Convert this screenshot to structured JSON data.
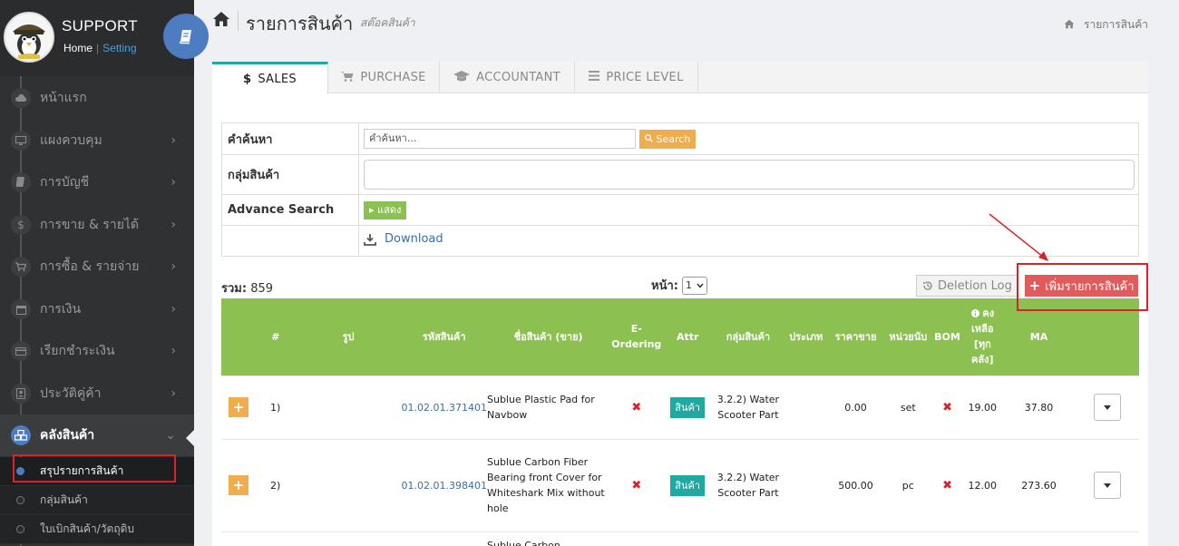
{
  "sidebar": {
    "brand_title": "SUPPORT",
    "home_label": "Home",
    "separator": "|",
    "setting_label": "Setting",
    "items": [
      {
        "label": "หน้าแรก",
        "icon": "cloud-icon",
        "has_chevron": false
      },
      {
        "label": "แผงควบคุม",
        "icon": "monitor-icon",
        "has_chevron": true
      },
      {
        "label": "การบัญชี",
        "icon": "book-icon",
        "has_chevron": true
      },
      {
        "label": "การขาย & รายได้",
        "icon": "dollar-icon",
        "has_chevron": true
      },
      {
        "label": "การซื้อ & รายจ่าย",
        "icon": "cart-icon",
        "has_chevron": true
      },
      {
        "label": "การเงิน",
        "icon": "calendar-icon",
        "has_chevron": true
      },
      {
        "label": "เรียกชำระเงิน",
        "icon": "credit-card-icon",
        "has_chevron": true
      },
      {
        "label": "ประวัติคู่ค้า",
        "icon": "contact-icon",
        "has_chevron": true
      },
      {
        "label": "คลังสินค้า",
        "icon": "cubes-icon",
        "has_chevron": true,
        "active": true
      }
    ],
    "sub_items": [
      {
        "label": "สรุปรายการสินค้า",
        "current": true
      },
      {
        "label": "กลุ่มสินค้า"
      },
      {
        "label": "ใบเบิกสินค้า/วัตถุดิบ"
      }
    ]
  },
  "header": {
    "title": "รายการสินค้า",
    "subtitle": "สต๊อคสินค้า",
    "breadcrumb": "รายการสินค้า"
  },
  "tabs": [
    {
      "label": "SALES",
      "icon": "$",
      "active": true
    },
    {
      "label": "PURCHASE",
      "icon": "cart-icon"
    },
    {
      "label": "ACCOUNTANT",
      "icon": "graduation-cap-icon"
    },
    {
      "label": "PRICE LEVEL",
      "icon": "list-icon"
    }
  ],
  "search": {
    "keyword_label": "คำค้นหา",
    "keyword_placeholder": "คำค้นหา...",
    "search_button": "Search",
    "group_label": "กลุ่มสินค้า",
    "group_value": "",
    "advance_label": "Advance Search",
    "show_button": "แสดง",
    "download_label": "Download"
  },
  "toolbar": {
    "total_label": "รวม:",
    "total_value": "859",
    "page_label": "หน้า:",
    "page_value": "1",
    "deletion_log": "Deletion Log",
    "add_button": "เพิ่มรายการสินค้า"
  },
  "table": {
    "headers": [
      "#",
      "รูป",
      "รหัสสินค้า",
      "ชื่อสินค้า (ขาย)",
      "E-Ordering",
      "Attr",
      "กลุ่มสินค้า",
      "ประเภท",
      "ราคาขาย",
      "หน่วยนับ",
      "BOM",
      "คงเหลือ [ทุกคลัง]",
      "MA"
    ],
    "rows": [
      {
        "num": "1)",
        "code": "01.02.01.371401",
        "name": "Sublue Plastic Pad for Navbow",
        "attr": "สินค้า",
        "group": "3.2.2) Water Scooter Part",
        "type": "",
        "price": "0.00",
        "unit": "set",
        "balance": "19.00",
        "ma": "37.80"
      },
      {
        "num": "2)",
        "code": "01.02.01.398401",
        "name": "Sublue Carbon Fiber Bearing front Cover for Whiteshark Mix without hole",
        "attr": "สินค้า",
        "group": "3.2.2) Water Scooter Part",
        "type": "",
        "price": "500.00",
        "unit": "pc",
        "balance": "12.00",
        "ma": "273.60"
      },
      {
        "num": "",
        "code": "",
        "name": "Sublue Carbon",
        "attr": "",
        "group": "",
        "type": "",
        "price": "",
        "unit": "",
        "balance": "",
        "ma": ""
      }
    ]
  },
  "colors": {
    "sidebar_bg": "#2f3133",
    "accent_blue": "#4d7cc0",
    "table_header": "#8cc152",
    "tab_active_border": "#1fa9a0",
    "add_button": "#e05c5c",
    "search_button": "#f0ad4e",
    "annotation_red": "#d9232a"
  }
}
